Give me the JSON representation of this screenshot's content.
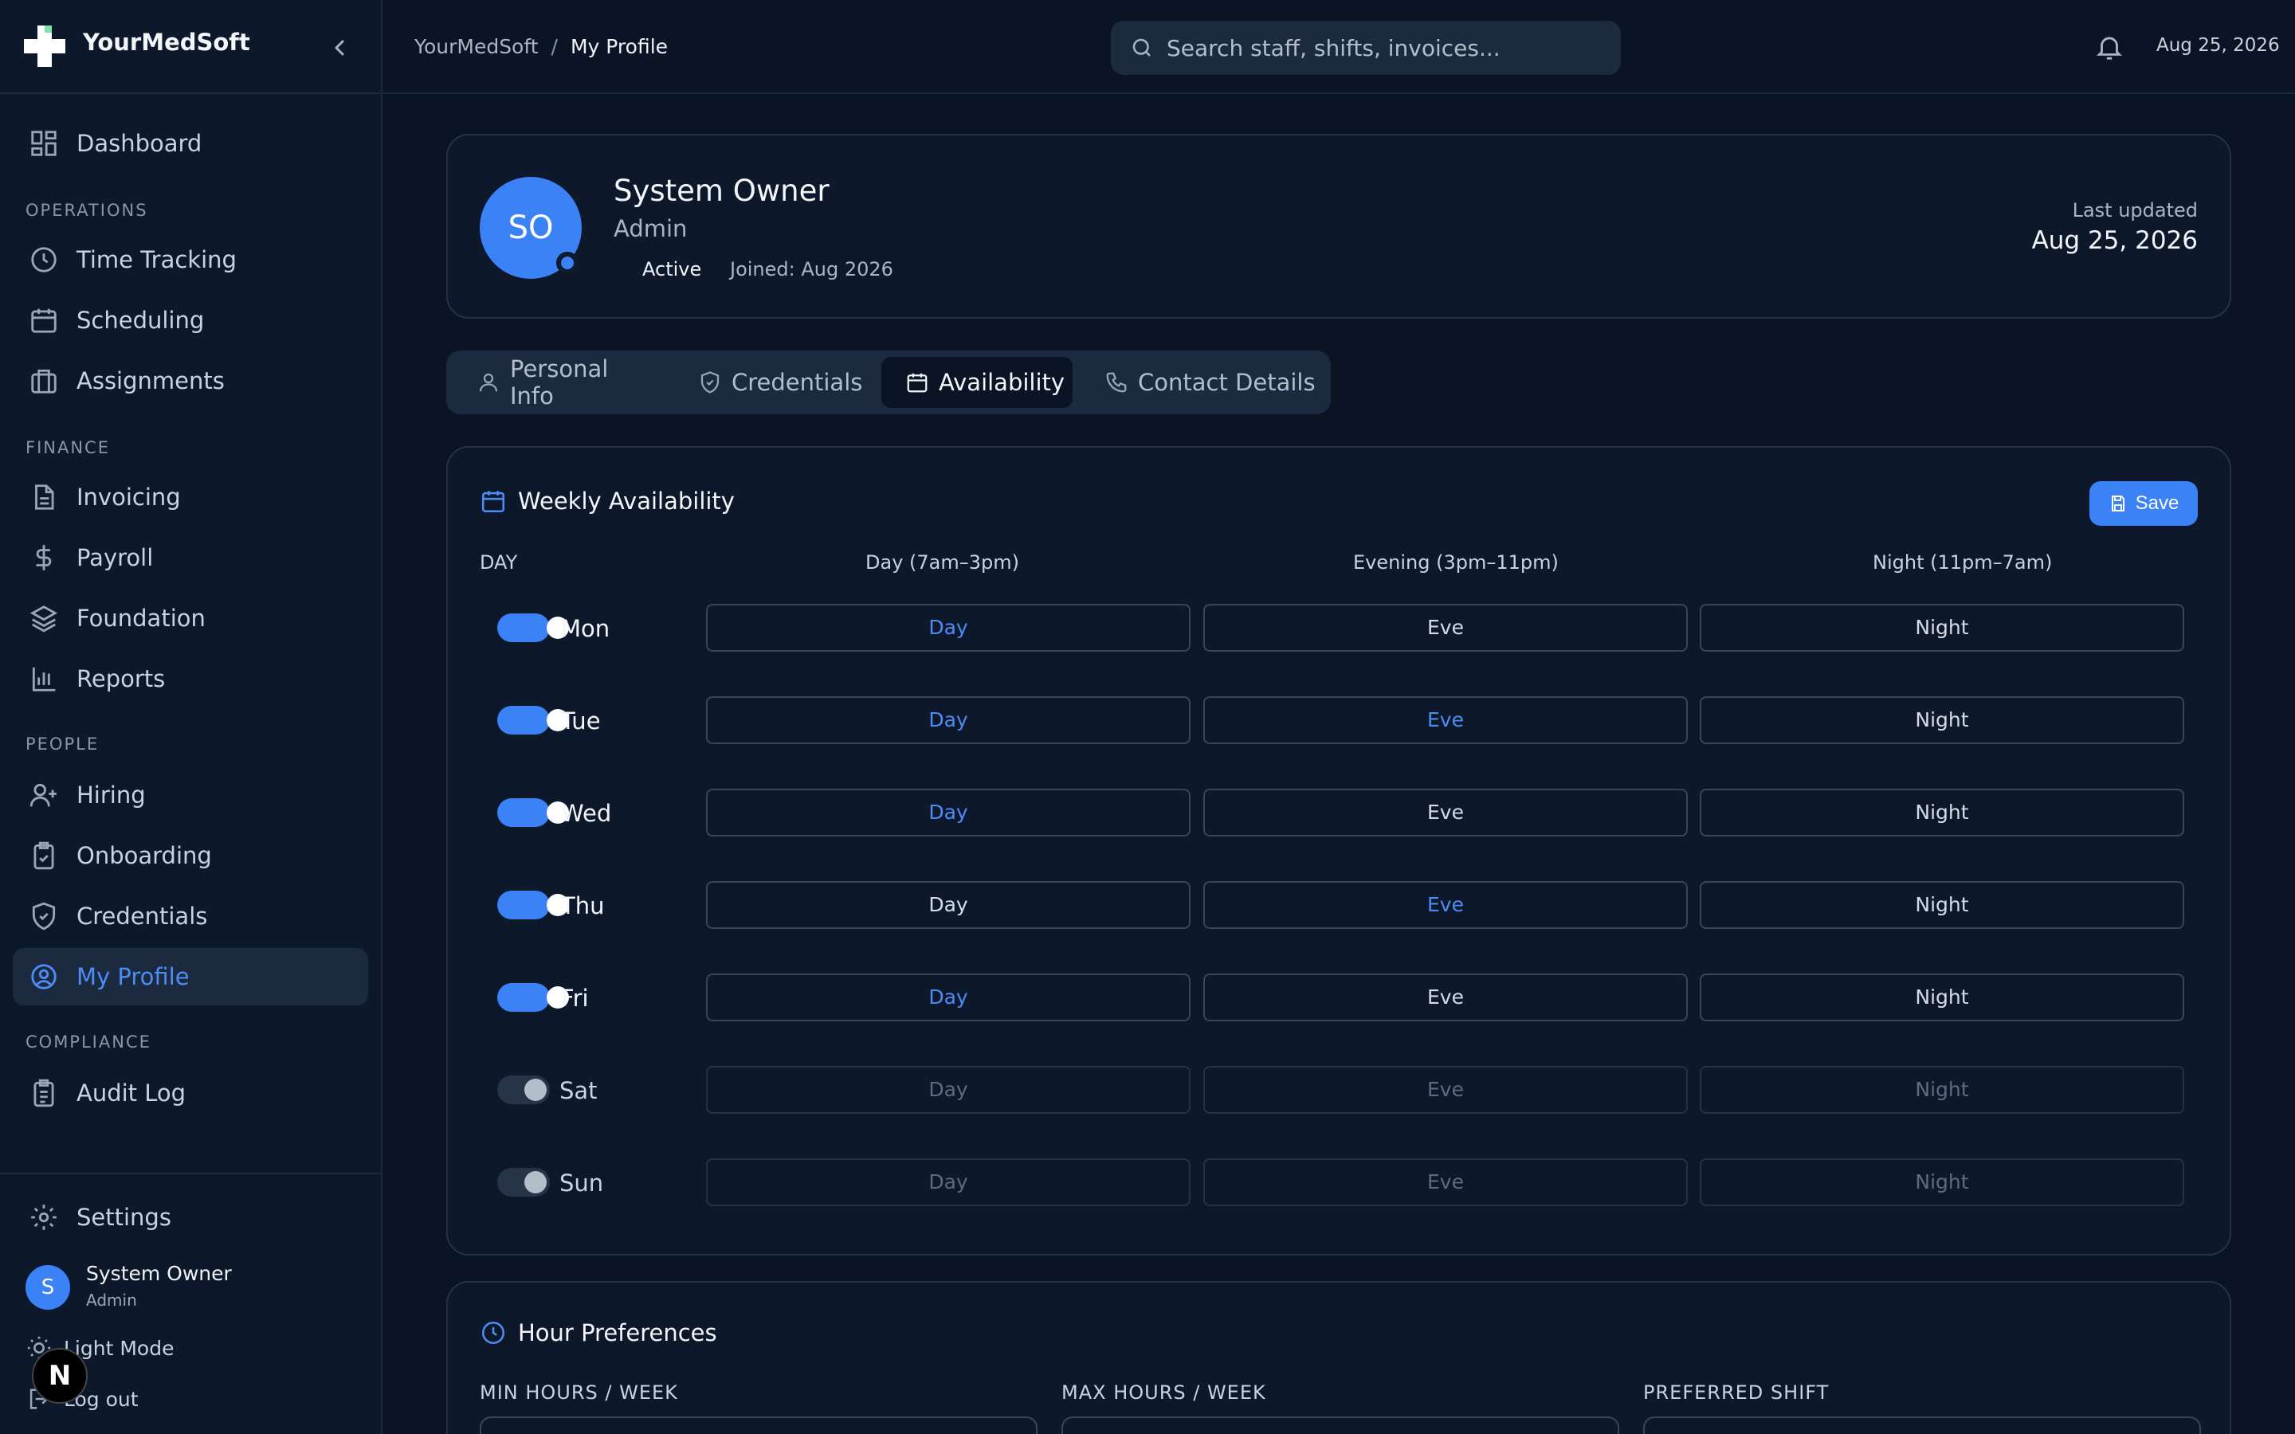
{
  "brand": {
    "name": "YourMedSoft"
  },
  "sidebar": {
    "dashboard": "Dashboard",
    "sections": {
      "operations": "OPERATIONS",
      "finance": "FINANCE",
      "people": "PEOPLE",
      "compliance": "COMPLIANCE"
    },
    "items": {
      "time_tracking": "Time Tracking",
      "scheduling": "Scheduling",
      "assignments": "Assignments",
      "invoicing": "Invoicing",
      "payroll": "Payroll",
      "foundation": "Foundation",
      "reports": "Reports",
      "hiring": "Hiring",
      "onboarding": "Onboarding",
      "credentials": "Credentials",
      "my_profile": "My Profile",
      "audit_log": "Audit Log"
    },
    "settings": "Settings",
    "user": {
      "initial": "S",
      "name": "System Owner",
      "role": "Admin"
    },
    "light_mode": "Light Mode",
    "logout": "Log out",
    "badge": "N"
  },
  "header": {
    "breadcrumb": {
      "root": "YourMedSoft",
      "sep": "/",
      "current": "My Profile"
    },
    "search_placeholder": "Search staff, shifts, invoices...",
    "date": "Aug 25, 2026"
  },
  "profile": {
    "initials": "SO",
    "name": "System Owner",
    "role": "Admin",
    "status": "Active",
    "joined": "Joined: Aug 2026",
    "last_updated_label": "Last updated",
    "last_updated_value": "Aug 25, 2026"
  },
  "tabs": {
    "personal_info": "Personal Info",
    "credentials": "Credentials",
    "availability": "Availability",
    "contact_details": "Contact Details"
  },
  "availability": {
    "title": "Weekly Availability",
    "save": "Save",
    "columns": {
      "day": "DAY",
      "day_shift": "Day (7am–3pm)",
      "evening_shift": "Evening (3pm–11pm)",
      "night_shift": "Night (11pm–7am)"
    },
    "slot_labels": {
      "day": "Day",
      "eve": "Eve",
      "night": "Night"
    },
    "days": [
      {
        "label": "Mon",
        "enabled": true
      },
      {
        "label": "Tue",
        "enabled": true
      },
      {
        "label": "Wed",
        "enabled": true
      },
      {
        "label": "Thu",
        "enabled": true
      },
      {
        "label": "Fri",
        "enabled": true
      },
      {
        "label": "Sat",
        "enabled": false
      },
      {
        "label": "Sun",
        "enabled": false
      }
    ]
  },
  "hours": {
    "title": "Hour Preferences",
    "min_label": "MIN HOURS / WEEK",
    "max_label": "MAX HOURS / WEEK",
    "preferred_label": "PREFERRED SHIFT"
  },
  "colors": {
    "accent": "#3b82f6",
    "background": "#0b1425",
    "panel": "#0d182b",
    "border": "#243349"
  }
}
